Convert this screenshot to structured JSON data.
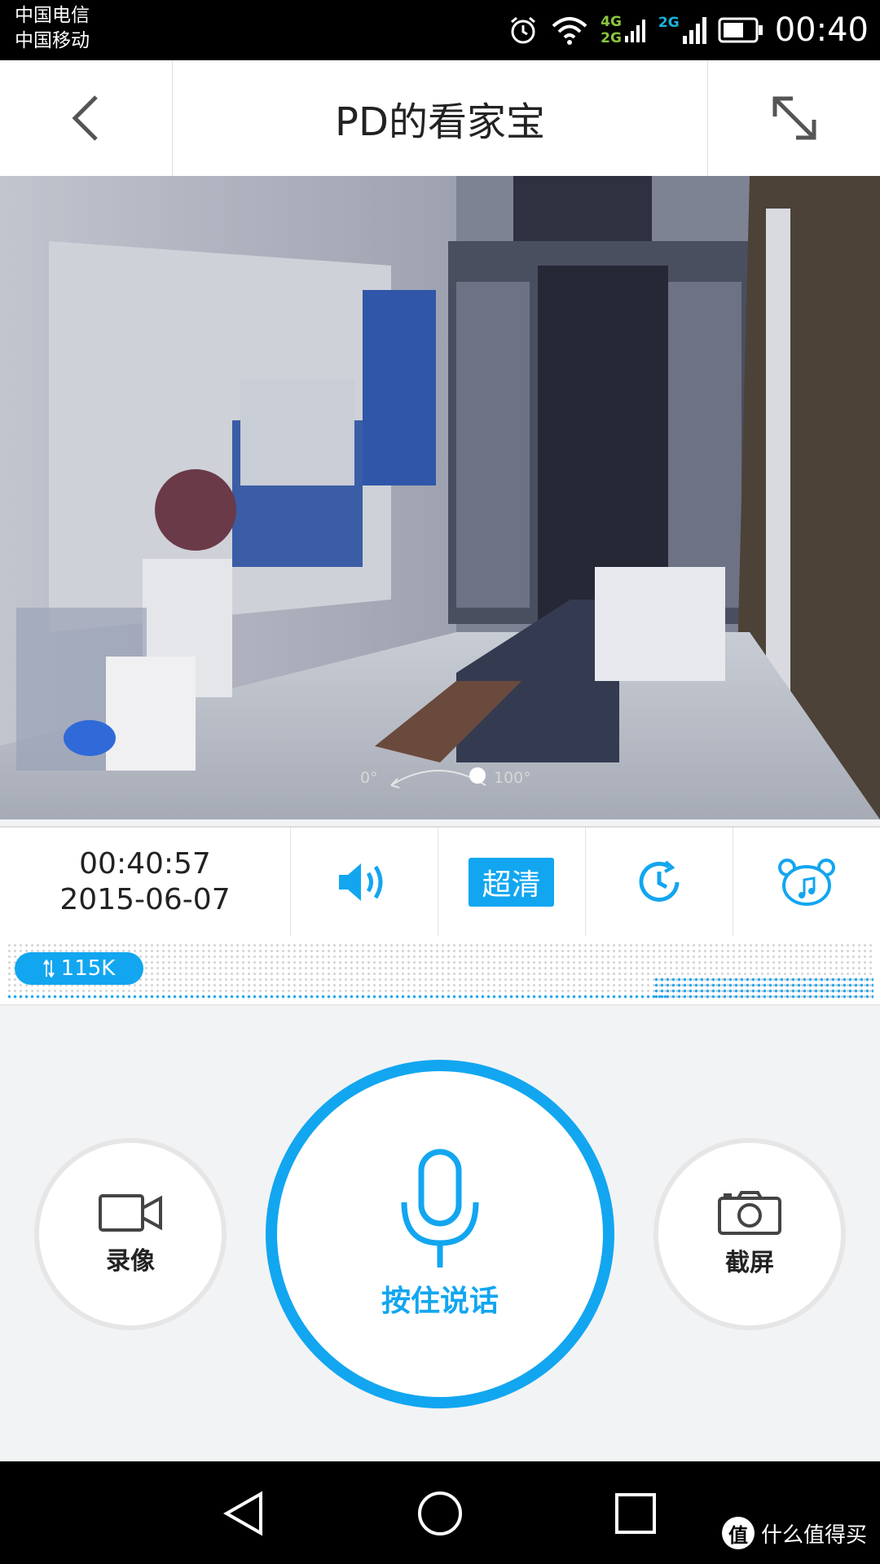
{
  "status_bar": {
    "carrier_1": "中国电信",
    "carrier_2": "中国移动",
    "net_1_top": "4G",
    "net_1_bottom": "2G",
    "net_2": "2G",
    "time": "00:40"
  },
  "header": {
    "title": "PD的看家宝"
  },
  "video": {
    "pan_min": "0°",
    "pan_max": "100°",
    "pan_fraction": 0.9
  },
  "info_bar": {
    "time": "00:40:57",
    "date": "2015-06-07",
    "quality_label": "超清"
  },
  "bitrate": {
    "value": "115K"
  },
  "controls": {
    "record_label": "录像",
    "talk_label": "按住说话",
    "screenshot_label": "截屏"
  },
  "watermark": {
    "logo": "值",
    "text": "什么值得买"
  },
  "colors": {
    "accent": "#12a6f0",
    "nav_background": "#000000"
  }
}
